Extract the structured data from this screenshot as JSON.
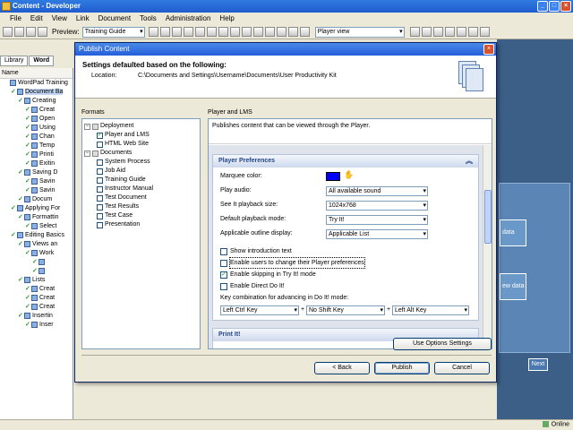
{
  "app": {
    "title": "Content - Developer",
    "menu": [
      "File",
      "Edit",
      "View",
      "Link",
      "Document",
      "Tools",
      "Administration",
      "Help"
    ],
    "toolbar": {
      "preview_label": "Preview:",
      "preview_value": "Training Guide",
      "view_value": "Player view"
    },
    "tabs": [
      "Library",
      "Word"
    ],
    "outline_header": "Name",
    "outline": [
      {
        "text": "WordPad Training",
        "indent": 0,
        "check": false
      },
      {
        "text": "Document Ba",
        "indent": 1,
        "check": true,
        "sel": true
      },
      {
        "text": "Creating",
        "indent": 2,
        "check": true
      },
      {
        "text": "Creat",
        "indent": 3,
        "check": true
      },
      {
        "text": "Open",
        "indent": 3,
        "check": true
      },
      {
        "text": "Using",
        "indent": 3,
        "check": true
      },
      {
        "text": "Chan",
        "indent": 3,
        "check": true
      },
      {
        "text": "Temp",
        "indent": 3,
        "check": true
      },
      {
        "text": "Printi",
        "indent": 3,
        "check": true
      },
      {
        "text": "Exitin",
        "indent": 3,
        "check": true
      },
      {
        "text": "Saving D",
        "indent": 2,
        "check": true
      },
      {
        "text": "Savin",
        "indent": 3,
        "check": true
      },
      {
        "text": "Savin",
        "indent": 3,
        "check": true
      },
      {
        "text": "Docum",
        "indent": 2,
        "check": true
      },
      {
        "text": "Applying For",
        "indent": 1,
        "check": true
      },
      {
        "text": "Formattin",
        "indent": 2,
        "check": true
      },
      {
        "text": "Select",
        "indent": 3,
        "check": true
      },
      {
        "text": "Editing Basics",
        "indent": 1,
        "check": true
      },
      {
        "text": "Views an",
        "indent": 2,
        "check": true
      },
      {
        "text": "Work",
        "indent": 3,
        "check": true
      },
      {
        "text": "",
        "indent": 4,
        "check": true
      },
      {
        "text": "",
        "indent": 4,
        "check": true
      },
      {
        "text": "Lists",
        "indent": 2,
        "check": true
      },
      {
        "text": "Creat",
        "indent": 3,
        "check": true
      },
      {
        "text": "Creat",
        "indent": 3,
        "check": true
      },
      {
        "text": "Creat",
        "indent": 3,
        "check": true
      },
      {
        "text": "Insertin",
        "indent": 2,
        "check": true
      },
      {
        "text": "Inser",
        "indent": 3,
        "check": true
      }
    ],
    "right_pane": {
      "box1": "data",
      "box2": "ew data",
      "next": "Next"
    },
    "status": "Online"
  },
  "dialog": {
    "title": "Publish Content",
    "header_title": "Settings defaulted based on the following:",
    "location_label": "Location:",
    "location_value": "C:\\Documents and Settings\\Username\\Documents\\User Productivity Kit",
    "formats_label": "Formats",
    "formats_tree": [
      {
        "text": "Deployment",
        "level": 0,
        "expander": "−",
        "checked": false
      },
      {
        "text": "Player and LMS",
        "level": 1,
        "checked": true
      },
      {
        "text": "HTML Web Site",
        "level": 1,
        "checked": false
      },
      {
        "text": "Documents",
        "level": 0,
        "expander": "−",
        "checked": false
      },
      {
        "text": "System Process",
        "level": 1,
        "checked": false
      },
      {
        "text": "Job Aid",
        "level": 1,
        "checked": false
      },
      {
        "text": "Training Guide",
        "level": 1,
        "checked": false
      },
      {
        "text": "Instructor Manual",
        "level": 1,
        "checked": false
      },
      {
        "text": "Test Document",
        "level": 1,
        "checked": false
      },
      {
        "text": "Test Results",
        "level": 1,
        "checked": false
      },
      {
        "text": "Test Case",
        "level": 1,
        "checked": false
      },
      {
        "text": "Presentation",
        "level": 1,
        "checked": false
      }
    ],
    "settings_label": "Player and LMS",
    "settings_desc": "Publishes content that can be viewed through the Player.",
    "player_prefs": {
      "title": "Player Preferences",
      "marquee_label": "Marquee color:",
      "marquee_color": "#0000ff",
      "play_audio_label": "Play audio:",
      "play_audio_value": "All available sound",
      "see_it_label": "See It playback size:",
      "see_it_value": "1024x768",
      "default_mode_label": "Default playback mode:",
      "default_mode_value": "Try It!",
      "outline_display_label": "Applicable outline display:",
      "outline_display_value": "Applicable List",
      "checks": [
        {
          "label": "Show introduction text",
          "checked": false
        },
        {
          "label": "Enable users to change their Player preferences",
          "checked": false,
          "focus": true
        },
        {
          "label": "Enable skipping in Try It! mode",
          "checked": true
        },
        {
          "label": "Enable Direct Do It!",
          "checked": false
        }
      ],
      "key_combo_label": "Key combination for advancing in Do It! mode:",
      "key1": "Left Ctrl Key",
      "key2": "No Shift Key",
      "key3": "Left Alt Key",
      "plus": "+"
    },
    "print_it_title": "Print It!",
    "use_options_button": "Use Options Settings",
    "back_button": "< Back",
    "publish_button": "Publish",
    "cancel_button": "Cancel"
  }
}
